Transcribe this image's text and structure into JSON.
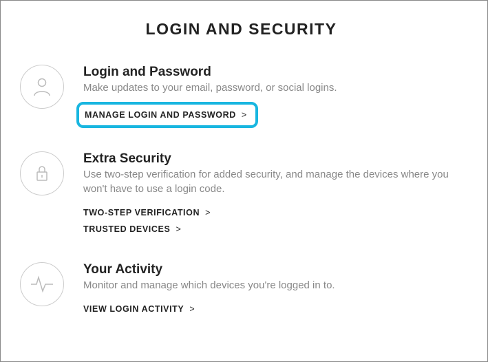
{
  "page": {
    "heading": "LOGIN AND SECURITY"
  },
  "sections": {
    "login": {
      "title": "Login and Password",
      "desc": "Make updates to your email, password, or social logins.",
      "link_manage": "MANAGE LOGIN AND PASSWORD"
    },
    "extra": {
      "title": "Extra Security",
      "desc": "Use two-step verification for added security, and manage the devices where you won't have to use a login code.",
      "link_twostep": "TWO-STEP VERIFICATION",
      "link_trusted": "TRUSTED DEVICES"
    },
    "activity": {
      "title": "Your Activity",
      "desc": "Monitor and manage which devices you're logged in to.",
      "link_view": "VIEW LOGIN ACTIVITY"
    }
  }
}
